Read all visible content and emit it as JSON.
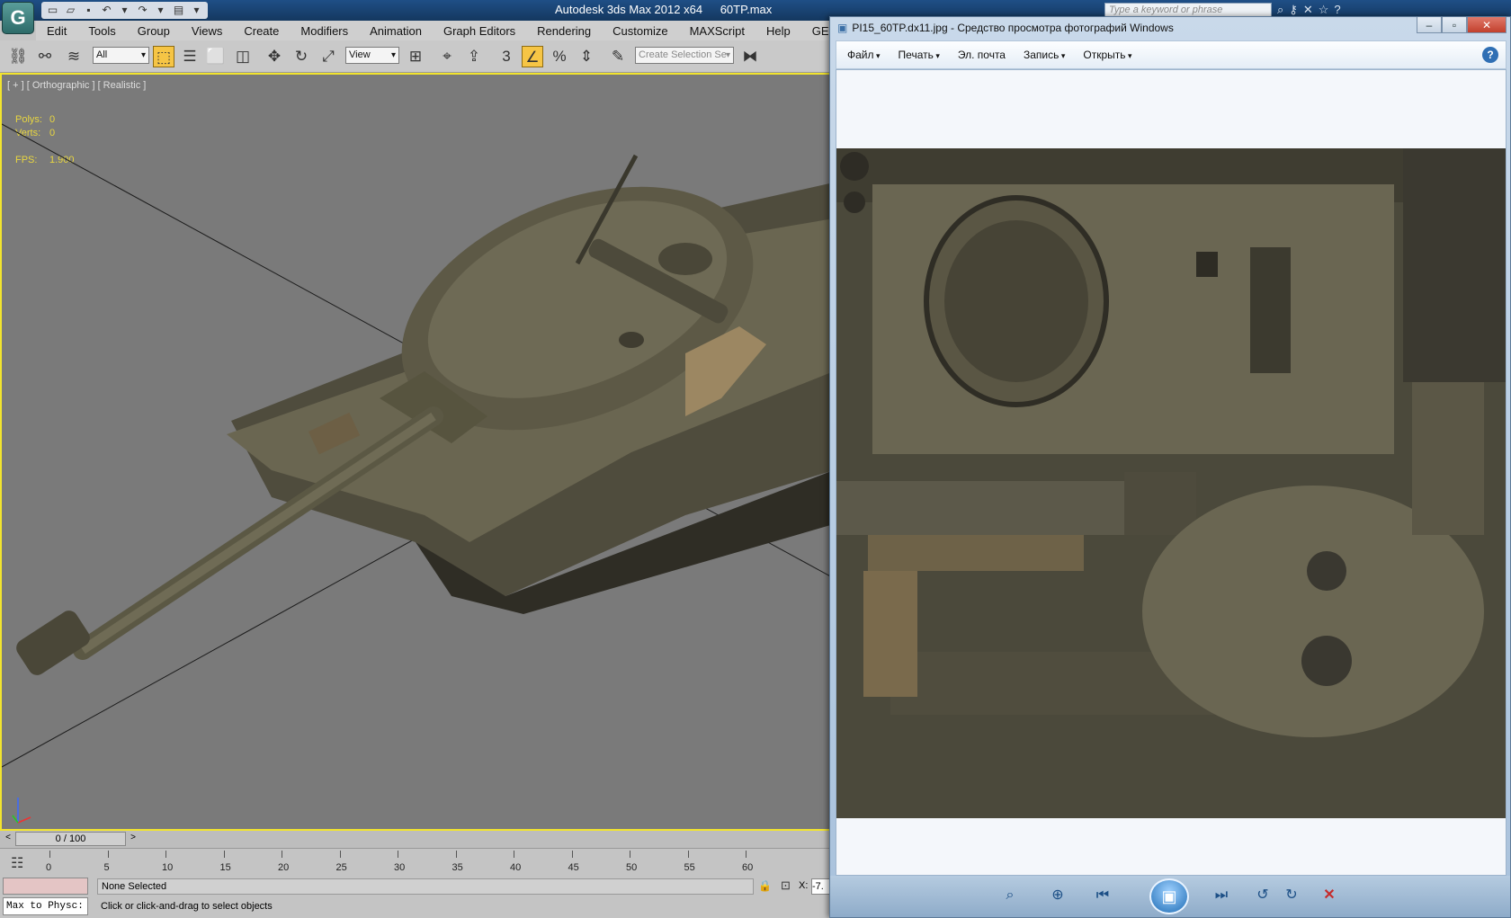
{
  "max": {
    "title": "Autodesk 3ds Max  2012 x64",
    "file": "60TP.max",
    "help_search_placeholder": "Type a keyword or phrase",
    "menu": [
      "Edit",
      "Tools",
      "Group",
      "Views",
      "Create",
      "Modifiers",
      "Animation",
      "Graph Editors",
      "Rendering",
      "Customize",
      "MAXScript",
      "Help",
      "GEM"
    ],
    "toolbar": {
      "selection_filter": "All",
      "reference_coord": "View",
      "named_selection_placeholder": "Create Selection Se"
    },
    "viewport": {
      "label": "[ + ] [ Orthographic ] [ Realistic ]",
      "polys_label": "Polys:",
      "polys_value": "0",
      "verts_label": "Verts:",
      "verts_value": "0",
      "fps_label": "FPS:",
      "fps_value": "1.900"
    },
    "time_slider": {
      "frame": "0 / 100",
      "prev": "<",
      "next": ">"
    },
    "trackbar_ticks": [
      "0",
      "5",
      "10",
      "15",
      "20",
      "25",
      "30",
      "35",
      "40",
      "45",
      "50",
      "55",
      "60"
    ],
    "status": {
      "maxscript": "Max to Physc:",
      "selection": "None Selected",
      "prompt": "Click or click-and-drag to select objects",
      "x_label": "X:",
      "x_value": "-7."
    }
  },
  "viewer": {
    "title": "PI15_60TP.dx11.jpg - Средство просмотра фотографий Windows",
    "menu": [
      {
        "label": "Файл",
        "dropdown": true
      },
      {
        "label": "Печать",
        "dropdown": true
      },
      {
        "label": "Эл. почта",
        "dropdown": false
      },
      {
        "label": "Запись",
        "dropdown": true
      },
      {
        "label": "Открыть",
        "dropdown": true
      }
    ],
    "help": "?",
    "controls": [
      "zoom-icon",
      "actual-size-icon",
      "previous-icon",
      "slideshow-icon",
      "next-icon",
      "rotate-ccw-icon",
      "rotate-cw-icon",
      "delete-icon"
    ]
  },
  "colors": {
    "viewport_bg": "#7a7a7a",
    "viewport_border": "#f2e42e",
    "stat_text": "#e8d640",
    "tank": "#5e5a47",
    "accent_blue": "#1f6db5"
  }
}
